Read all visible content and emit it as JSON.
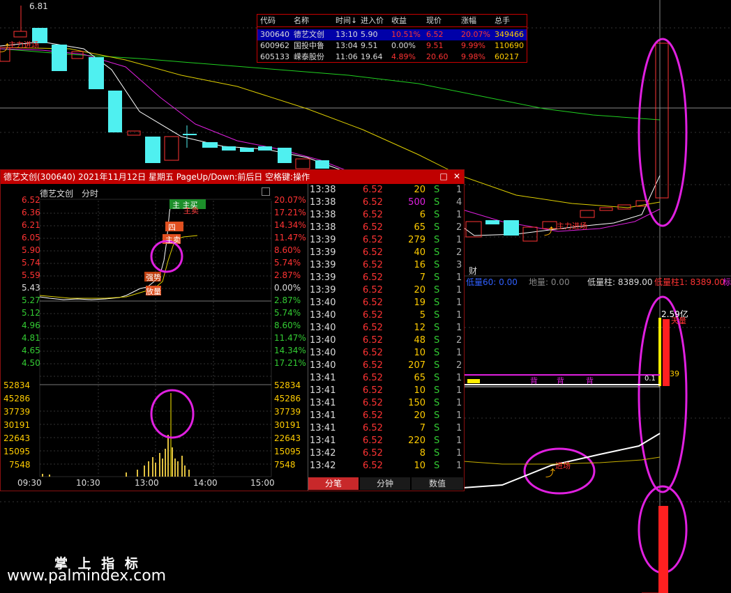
{
  "main_chart": {
    "high_price_label": "6.81",
    "annotation_top_left": "主力进场",
    "annotation_bottom": "主力进场",
    "indicator_left_label": "财"
  },
  "watchlist": {
    "headers": [
      "代码",
      "名称",
      "时间↓",
      "进入价",
      "收益",
      "现价",
      "涨幅",
      "总手"
    ],
    "rows": [
      {
        "code": "300640",
        "name": "德艺文创",
        "time": "13:10",
        "entry": "5.90",
        "gain": "10.51%",
        "price": "6.52",
        "change": "20.07%",
        "volume": "349466",
        "selected": true
      },
      {
        "code": "600962",
        "name": "国投中鲁",
        "time": "13:04",
        "entry": "9.51",
        "gain": "0.00%",
        "price": "9.51",
        "change": "9.99%",
        "volume": "110690",
        "selected": false
      },
      {
        "code": "605133",
        "name": "嵘泰股份",
        "time": "11:06",
        "entry": "19.64",
        "gain": "4.89%",
        "price": "20.60",
        "change": "9.98%",
        "volume": "60217",
        "selected": false
      }
    ]
  },
  "indicator_bar": {
    "low1": "低量60: 0.00",
    "low2": "地量: 0.00",
    "low3": "低量柱: 8389.00",
    "low4": "低量柱1: 8389.00",
    "low5": "标"
  },
  "volume_panel": {
    "value_label": "2.59亿",
    "tag": "天量",
    "small_value": "39",
    "mini_value": "0.1",
    "bei_marks": [
      "背",
      "背",
      "背"
    ]
  },
  "lower_indicator": {
    "annotation": "进场"
  },
  "popup": {
    "title": "德艺文创(300640) 2021年11月12日 星期五 PageUp/Down:前后日 空格键:操作",
    "restore_icon": "□",
    "close_icon": "✕",
    "chart_header_name": "德艺文创",
    "chart_header_mode": "分时",
    "price_ticks_left": [
      "6.52",
      "6.36",
      "6.21",
      "6.05",
      "5.90",
      "5.74",
      "5.59",
      "5.43",
      "5.27",
      "5.12",
      "4.96",
      "4.81",
      "4.65",
      "4.50"
    ],
    "pct_ticks_right": [
      "20.07%",
      "17.21%",
      "14.34%",
      "11.47%",
      "8.60%",
      "5.74%",
      "2.87%",
      "0.00%",
      "2.87%",
      "5.74%",
      "8.60%",
      "11.47%",
      "14.34%",
      "17.21%"
    ],
    "vol_ticks": [
      "52834",
      "45286",
      "37739",
      "30191",
      "22643",
      "15095",
      "7548"
    ],
    "time_axis": [
      "09:30",
      "10:30",
      "13:00",
      "14:00",
      "15:00"
    ],
    "chart_tags": [
      "主 主买",
      "主卖",
      "四",
      "主卖",
      "强势",
      "放量"
    ],
    "ticks": [
      {
        "time": "13:38",
        "price": "6.52",
        "vol": "20",
        "side": "S",
        "n": "1"
      },
      {
        "time": "13:38",
        "price": "6.52",
        "vol": "500",
        "side": "S",
        "n": "4"
      },
      {
        "time": "13:38",
        "price": "6.52",
        "vol": "6",
        "side": "S",
        "n": "1"
      },
      {
        "time": "13:38",
        "price": "6.52",
        "vol": "65",
        "side": "S",
        "n": "2"
      },
      {
        "time": "13:39",
        "price": "6.52",
        "vol": "279",
        "side": "S",
        "n": "1"
      },
      {
        "time": "13:39",
        "price": "6.52",
        "vol": "40",
        "side": "S",
        "n": "2"
      },
      {
        "time": "13:39",
        "price": "6.52",
        "vol": "16",
        "side": "S",
        "n": "3"
      },
      {
        "time": "13:39",
        "price": "6.52",
        "vol": "7",
        "side": "S",
        "n": "1"
      },
      {
        "time": "13:39",
        "price": "6.52",
        "vol": "20",
        "side": "S",
        "n": "1"
      },
      {
        "time": "13:40",
        "price": "6.52",
        "vol": "19",
        "side": "S",
        "n": "1"
      },
      {
        "time": "13:40",
        "price": "6.52",
        "vol": "5",
        "side": "S",
        "n": "1"
      },
      {
        "time": "13:40",
        "price": "6.52",
        "vol": "12",
        "side": "S",
        "n": "1"
      },
      {
        "time": "13:40",
        "price": "6.52",
        "vol": "48",
        "side": "S",
        "n": "2"
      },
      {
        "time": "13:40",
        "price": "6.52",
        "vol": "10",
        "side": "S",
        "n": "1"
      },
      {
        "time": "13:40",
        "price": "6.52",
        "vol": "207",
        "side": "S",
        "n": "2"
      },
      {
        "time": "13:41",
        "price": "6.52",
        "vol": "65",
        "side": "S",
        "n": "1"
      },
      {
        "time": "13:41",
        "price": "6.52",
        "vol": "10",
        "side": "S",
        "n": "1"
      },
      {
        "time": "13:41",
        "price": "6.52",
        "vol": "150",
        "side": "S",
        "n": "1"
      },
      {
        "time": "13:41",
        "price": "6.52",
        "vol": "20",
        "side": "S",
        "n": "1"
      },
      {
        "time": "13:41",
        "price": "6.52",
        "vol": "7",
        "side": "S",
        "n": "1"
      },
      {
        "time": "13:41",
        "price": "6.52",
        "vol": "220",
        "side": "S",
        "n": "1"
      },
      {
        "time": "13:42",
        "price": "6.52",
        "vol": "8",
        "side": "S",
        "n": "1"
      },
      {
        "time": "13:42",
        "price": "6.52",
        "vol": "10",
        "side": "S",
        "n": "1"
      }
    ],
    "tabs": [
      "分笔",
      "分钟",
      "数值"
    ]
  },
  "watermark": {
    "line1": "掌 上 指 标",
    "line2": "www.palmindex.com"
  },
  "colors": {
    "up_red": "#ff3333",
    "down_cyan": "#4ff0f0",
    "magenta": "#e020e0",
    "title_red": "#c00000",
    "green_text": "#33cc33"
  }
}
